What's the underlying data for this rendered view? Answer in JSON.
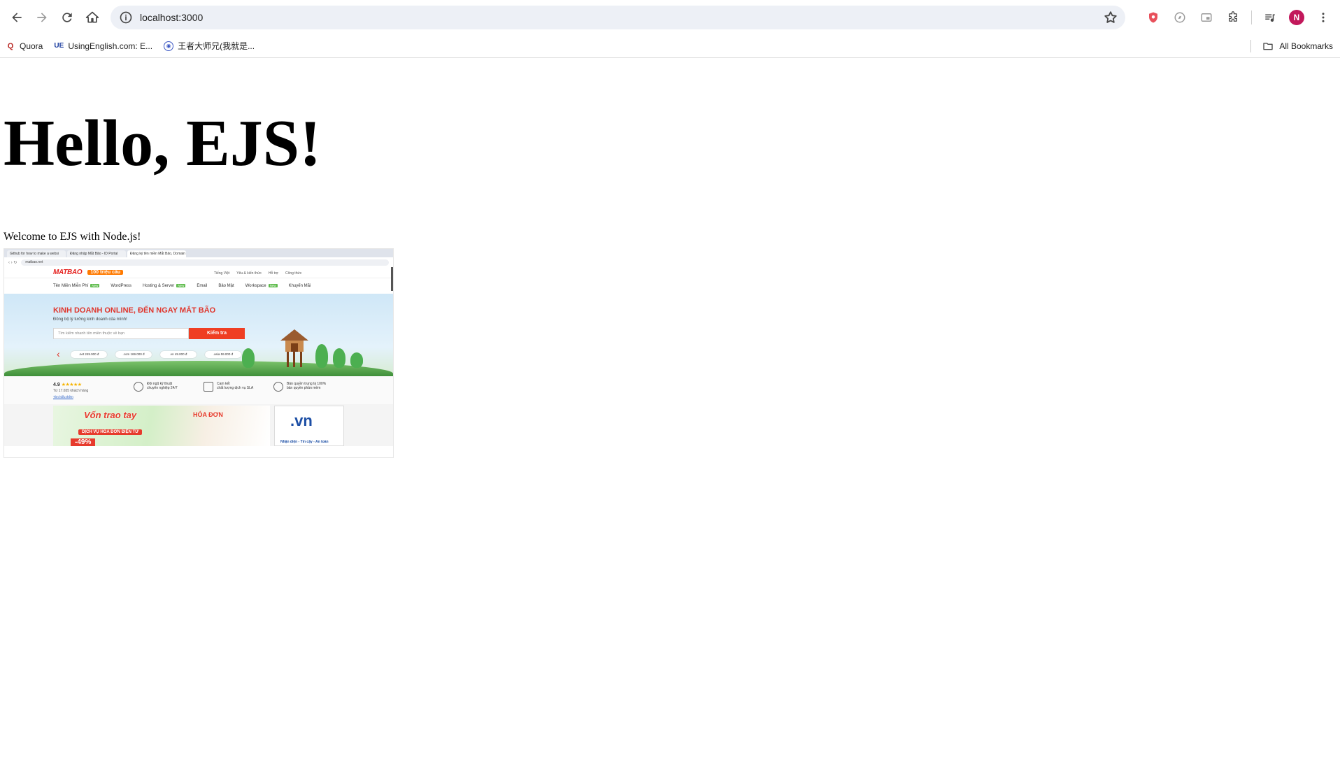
{
  "browser": {
    "url": "localhost:3000",
    "profile_initial": "N",
    "bookmarks": [
      {
        "label": "Quora",
        "icon": "quora-icon"
      },
      {
        "label": "UsingEnglish.com: E...",
        "icon": "usingenglish-icon"
      },
      {
        "label": "王者大师兄(我就是...",
        "icon": "profile-icon"
      }
    ],
    "all_bookmarks_label": "All Bookmarks"
  },
  "page": {
    "heading": "Hello, EJS!",
    "welcome": "Welcome to EJS with Node.js!"
  },
  "screenshot": {
    "tabs": [
      "Github for how to make a websi",
      "Đăng nhập Mắt Bão - ID Portal",
      "Đăng ký tên miền Mắt Bão, Domain"
    ],
    "url": "matbao.net",
    "logo": "MATBAO",
    "badge": "100 triệu cầu",
    "top_links": [
      "Tiếng Việt",
      "Yêu & kiến thức",
      "Hỗ trợ",
      "Công thức"
    ],
    "nav": [
      "Tên Miền Miễn Phí",
      "WordPress",
      "Hosting & Server",
      "Email",
      "Bảo Mật",
      "Workspace",
      "Khuyến Mãi"
    ],
    "nav_new_tags": [
      "New",
      "New",
      "New"
    ],
    "hero_title": "KINH DOANH ONLINE, ĐẾN NGAY MẮT BÃO",
    "hero_sub": "Đồng bộ lý tưởng kinh doanh của mình!",
    "search_placeholder": "Tìm kiếm nhanh tên miền thuộc về bạn",
    "search_button": "Kiểm tra",
    "prices": [
      ".net 249.000 đ",
      ".com 169.000 đ",
      ".vn 49.000 đ",
      ".asia 59.000 đ"
    ],
    "rating": "4.9",
    "stars": "★★★★★",
    "rating_sub": "Từ 17.655 khách hàng",
    "rating_link": "Tìm hiểu thêm",
    "features": [
      {
        "line1": "Đội ngũ kỹ thuật",
        "line2": "chuyên nghiệp 24/7"
      },
      {
        "line1": "Cam kết",
        "line2": "chất lượng dịch vụ SLA"
      },
      {
        "line1": "Bản quyền trung là 100%",
        "line2": "bản quyền phần mềm"
      }
    ],
    "banner_title": "Vốn trao tay",
    "banner_service": "DỊCH VỤ HÓA ĐƠN ĐIỆN TỬ",
    "banner_invoice": "HÓA ĐƠN",
    "banner_discount": "-49%",
    "vn_logo": ".vn",
    "vn_sub": "Nhận diện - Tin cậy - An toàn"
  }
}
